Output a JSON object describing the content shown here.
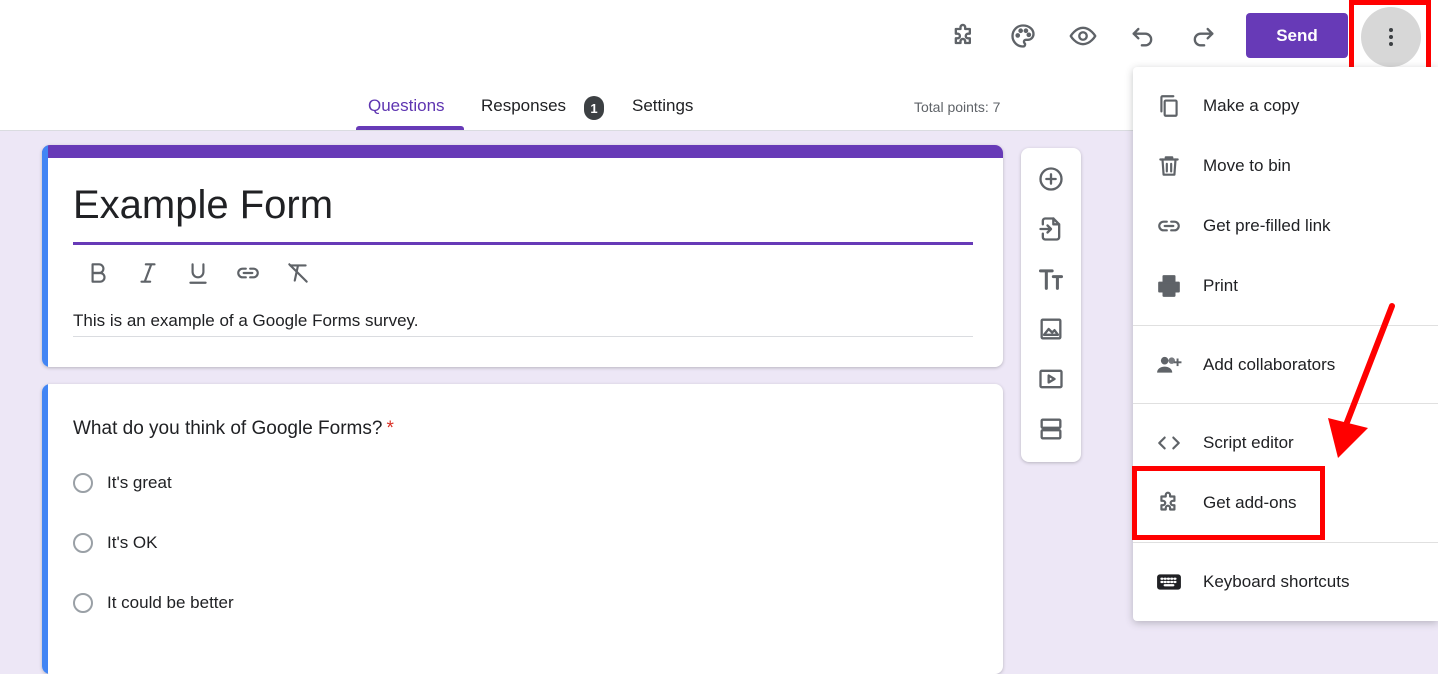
{
  "toolbar": {
    "send_label": "Send",
    "icons": [
      "addons-icon",
      "palette-icon",
      "preview-icon",
      "undo-icon",
      "redo-icon",
      "more-vert-icon"
    ]
  },
  "tabs": [
    {
      "label": "Questions",
      "active": true
    },
    {
      "label": "Responses",
      "badge": "1"
    },
    {
      "label": "Settings"
    }
  ],
  "total_points": "Total points: 7",
  "form": {
    "title": "Example Form",
    "description": "This is an example of a Google Forms survey.",
    "question": {
      "text": "What do you think of Google Forms?",
      "required_mark": "*",
      "options": [
        "It's great",
        "It's OK",
        "It could be better"
      ]
    }
  },
  "menu": {
    "items": [
      {
        "label": "Make a copy",
        "icon": "copy-icon"
      },
      {
        "label": "Move to bin",
        "icon": "trash-icon"
      },
      {
        "label": "Get pre-filled link",
        "icon": "link-icon"
      },
      {
        "label": "Print",
        "icon": "print-icon"
      },
      {
        "label": "Add collaborators",
        "icon": "collaborators-icon"
      },
      {
        "label": "Script editor",
        "icon": "code-icon"
      },
      {
        "label": "Get add-ons",
        "icon": "addons-icon"
      },
      {
        "label": "Keyboard shortcuts",
        "icon": "keyboard-icon"
      }
    ]
  },
  "colors": {
    "accent": "#673ab7",
    "background": "#ede7f6",
    "highlight": "#ff0000",
    "question_bar": "#4285f4"
  }
}
